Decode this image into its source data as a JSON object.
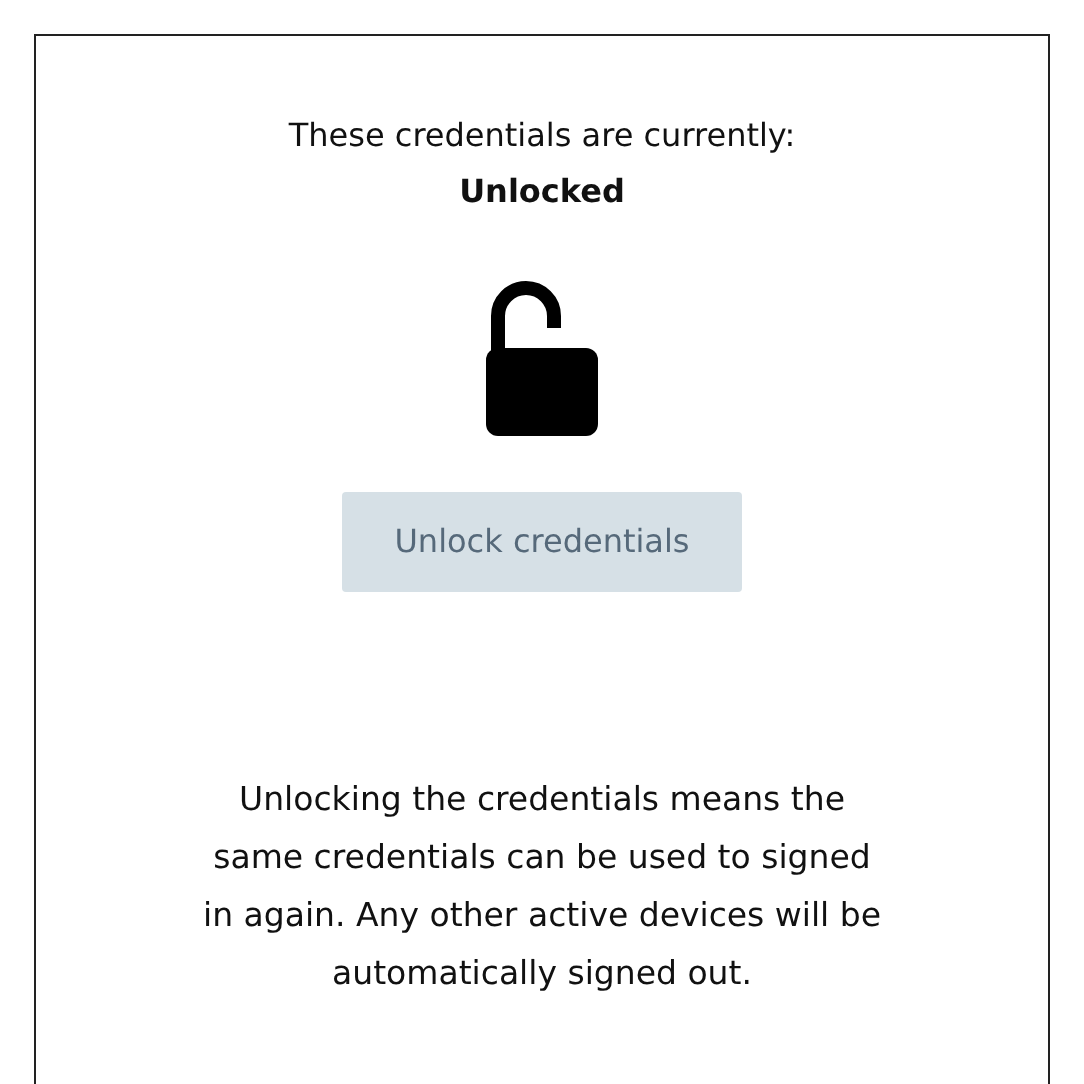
{
  "status_label": "These credentials are currently:",
  "status": "Unlocked",
  "locked": false,
  "button": {
    "label": "Unlock credentials",
    "disabled": true
  },
  "description": "Unlocking the credentials means the same credentials can be used to signed in again. Any other active devices will be automatically signed out."
}
